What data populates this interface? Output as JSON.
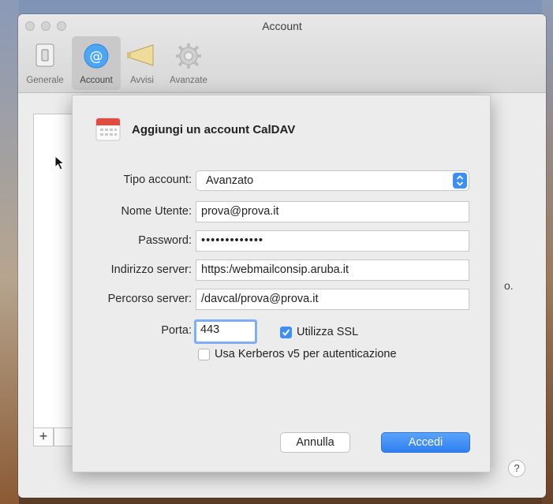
{
  "window": {
    "title": "Account"
  },
  "toolbar": {
    "items": [
      {
        "label": "Generale",
        "icon": "switch-icon"
      },
      {
        "label": "Account",
        "icon": "at-icon",
        "selected": true
      },
      {
        "label": "Avvisi",
        "icon": "megaphone-icon"
      },
      {
        "label": "Avanzate",
        "icon": "gear-icon"
      }
    ]
  },
  "background": {
    "plus_label": "+",
    "truncated_text": "o.",
    "help_label": "?"
  },
  "sheet": {
    "title": "Aggiungi un account CalDAV",
    "fields": {
      "account_type": {
        "label": "Tipo account:",
        "value": "Avanzato"
      },
      "username": {
        "label": "Nome Utente:",
        "value": "prova@prova.it"
      },
      "password": {
        "label": "Password:",
        "value": "•••••••••••••"
      },
      "server_address": {
        "label": "Indirizzo server:",
        "value": "https:/webmailconsip.aruba.it"
      },
      "server_path": {
        "label": "Percorso server:",
        "value": "/davcal/prova@prova.it"
      },
      "port": {
        "label": "Porta:",
        "value": "443"
      }
    },
    "use_ssl": {
      "label": "Utilizza SSL",
      "checked": true
    },
    "kerberos": {
      "label": "Usa Kerberos v5 per autenticazione",
      "checked": false
    },
    "buttons": {
      "cancel": "Annulla",
      "sign_in": "Accedi"
    }
  },
  "colors": {
    "accent": "#3b8ff6"
  }
}
